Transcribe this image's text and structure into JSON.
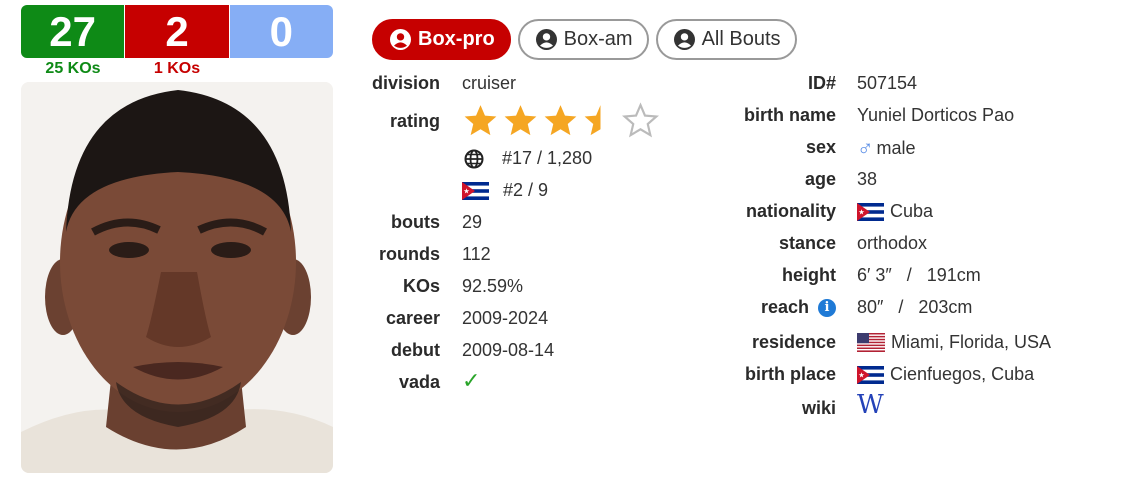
{
  "record": {
    "wins": "27",
    "losses": "2",
    "draws": "0",
    "wins_kos": "25 KOs",
    "losses_kos": "1 KOs"
  },
  "colors": {
    "win": "#0e8a16",
    "loss": "#c60000",
    "draw": "#86aef5",
    "star": "#f5a623"
  },
  "tabs": [
    {
      "label": "Box-pro",
      "active": true
    },
    {
      "label": "Box-am",
      "active": false
    },
    {
      "label": "All Bouts",
      "active": false
    }
  ],
  "left": {
    "division": {
      "label": "division",
      "value": "cruiser"
    },
    "rating": {
      "label": "rating",
      "stars": 3.5,
      "max": 5,
      "world_rank": "#17 / 1,280",
      "country_rank": "#2 / 9"
    },
    "bouts": {
      "label": "bouts",
      "value": "29"
    },
    "rounds": {
      "label": "rounds",
      "value": "112"
    },
    "kos": {
      "label": "KOs",
      "value": "92.59%"
    },
    "career": {
      "label": "career",
      "value": "2009-2024"
    },
    "debut": {
      "label": "debut",
      "value": "2009-08-14"
    },
    "vada": {
      "label": "vada",
      "value": "✓"
    }
  },
  "right": {
    "id": {
      "label": "ID#",
      "value": "507154"
    },
    "birth_name": {
      "label": "birth name",
      "value": "Yuniel Dorticos Pao"
    },
    "sex": {
      "label": "sex",
      "value": "male",
      "icon": "male-icon"
    },
    "age": {
      "label": "age",
      "value": "38"
    },
    "nationality": {
      "label": "nationality",
      "value": "Cuba",
      "icon": "cuba-flag-icon"
    },
    "stance": {
      "label": "stance",
      "value": "orthodox"
    },
    "height": {
      "label": "height",
      "value": "6′ 3″   /   191cm"
    },
    "reach": {
      "label": "reach",
      "value": "80″   /   203cm",
      "icon": "info-icon"
    },
    "residence": {
      "label": "residence",
      "value": "Miami, Florida, USA",
      "icon": "usa-flag-icon"
    },
    "birth_place": {
      "label": "birth place",
      "value": "Cienfuegos, Cuba",
      "icon": "cuba-flag-icon"
    },
    "wiki": {
      "label": "wiki",
      "value": "W",
      "icon": "wikipedia-icon"
    }
  }
}
